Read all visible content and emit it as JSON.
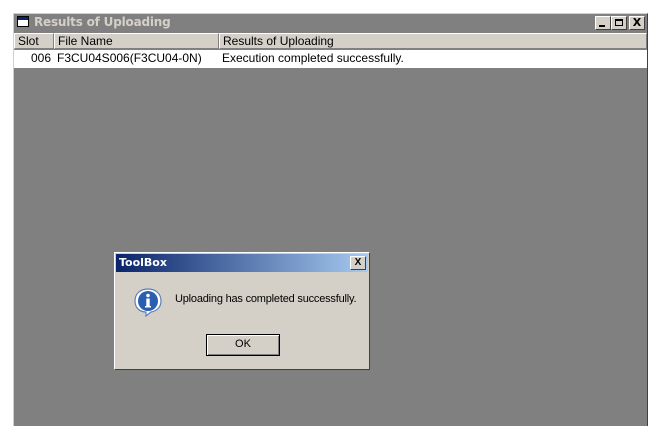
{
  "window": {
    "title": "Results of Uploading",
    "icon": "app-window-icon",
    "controls": {
      "minimize": "_",
      "maximize": "□",
      "close": "X"
    }
  },
  "table": {
    "columns": [
      "Slot",
      "File Name",
      "Results of Uploading"
    ],
    "rows": [
      {
        "slot": "006",
        "file_name": "F3CU04S006(F3CU04-0N)",
        "result": "Execution completed successfully."
      }
    ]
  },
  "dialog": {
    "title": "ToolBox",
    "close_label": "X",
    "icon": "info-icon",
    "message": "Uploading has completed successfully.",
    "ok_label": "OK"
  },
  "colors": {
    "dialog_title_gradient_start": "#0a246a",
    "dialog_title_gradient_end": "#a6caf0",
    "inactive_title": "#808080",
    "face": "#d4d0c8",
    "workspace": "#808080"
  }
}
